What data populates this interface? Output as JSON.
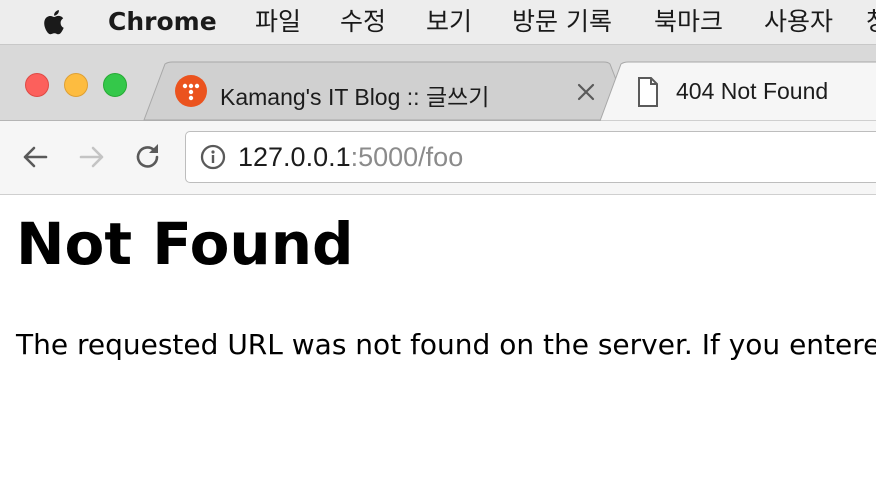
{
  "menubar": {
    "app_name": "Chrome",
    "items": [
      "파일",
      "수정",
      "보기",
      "방문 기록",
      "북마크",
      "사용자",
      "창"
    ]
  },
  "tabs": [
    {
      "title": "Kamang's IT Blog :: 글쓰기",
      "favicon": "tistory-icon",
      "active": false
    },
    {
      "title": "404 Not Found",
      "favicon": "document-icon",
      "active": true
    }
  ],
  "omnibox": {
    "url_host": "127.0.0.1",
    "url_rest": ":5000/foo"
  },
  "page": {
    "heading": "Not Found",
    "paragraph": "The requested URL was not found on the server. If you entered"
  },
  "colors": {
    "traffic_red": "#fc605c",
    "traffic_yellow": "#fdbc40",
    "traffic_green": "#34c84a",
    "favicon_orange": "#eb531e"
  }
}
